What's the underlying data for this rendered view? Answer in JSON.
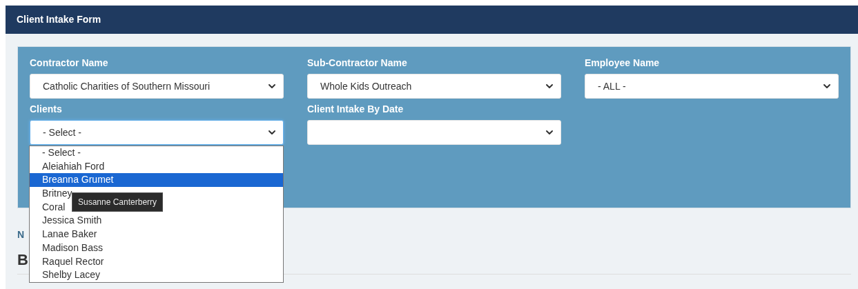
{
  "header": {
    "title": "Client Intake Form"
  },
  "filters": [
    {
      "label": "Contractor Name",
      "value": "Catholic Charities of Southern Missouri",
      "focused": false
    },
    {
      "label": "Sub-Contractor Name",
      "value": "Whole Kids Outreach",
      "focused": false
    },
    {
      "label": "Employee Name",
      "value": "- ALL -",
      "focused": false
    },
    {
      "label": "Clients",
      "value": "- Select -",
      "focused": true
    },
    {
      "label": "Client Intake By Date",
      "focused": false
    }
  ],
  "background_texts": [
    {
      "kind": "caption",
      "text": "N"
    },
    {
      "kind": "heading",
      "text": "B"
    }
  ],
  "dropdown": {
    "options": [
      {
        "label": "- Select -",
        "selected": false
      },
      {
        "label": "Aleiahiah Ford",
        "selected": false
      },
      {
        "label": "Breanna Grumet",
        "selected": true
      },
      {
        "label": "Britney",
        "selected": false
      },
      {
        "label": "Coral",
        "selected": false
      },
      {
        "label": "Jessica Smith",
        "selected": false
      },
      {
        "label": "Lanae Baker",
        "selected": false
      },
      {
        "label": "Madison Bass",
        "selected": false
      },
      {
        "label": "Raquel Rector",
        "selected": false
      },
      {
        "label": "Shelby Lacey",
        "selected": false
      }
    ],
    "tooltip": "Susanne Canterberry"
  }
}
